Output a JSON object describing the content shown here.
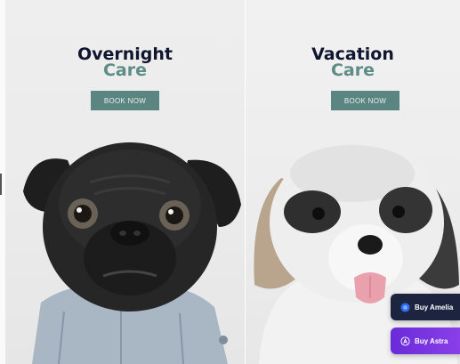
{
  "cards": [
    {
      "title_line1": "Overnight",
      "title_line2": "Care",
      "button_label": "BOOK NOW",
      "image": "pug-dog-in-denim-jacket"
    },
    {
      "title_line1": "Vacation",
      "title_line2": "Care",
      "button_label": "BOOK NOW",
      "image": "shih-tzu-dog-tongue-out"
    }
  ],
  "floating_buttons": {
    "amelia": {
      "label": "Buy Amelia",
      "icon": "amelia-logo-icon"
    },
    "astra": {
      "label": "Buy Astra",
      "icon": "astra-logo-icon"
    }
  },
  "colors": {
    "title_dark": "#10162f",
    "title_accent": "#5e8d87",
    "button_bg": "#5a8580",
    "amelia_bg": "#1d2440",
    "astra_bg": "#7a35e0"
  }
}
